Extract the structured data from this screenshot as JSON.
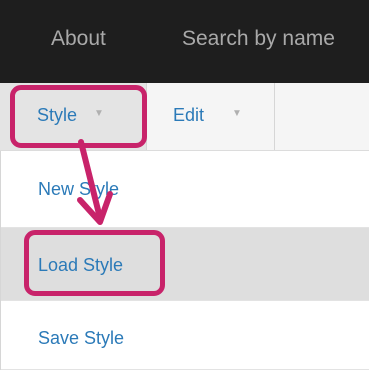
{
  "topbar": {
    "items": [
      {
        "label": "About"
      },
      {
        "label": "Search by name"
      }
    ]
  },
  "menubar": {
    "style_label": "Style",
    "edit_label": "Edit",
    "caret_icon": "caret-down-icon"
  },
  "dropdown": {
    "items": [
      {
        "label": "New Style"
      },
      {
        "label": "Load Style"
      },
      {
        "label": "Save Style"
      }
    ]
  },
  "colors": {
    "topbar_bg": "#1e1e1e",
    "link_blue": "#2b7ab8",
    "highlight_pink": "#c8236a",
    "selected_row_bg": "#dedede"
  }
}
